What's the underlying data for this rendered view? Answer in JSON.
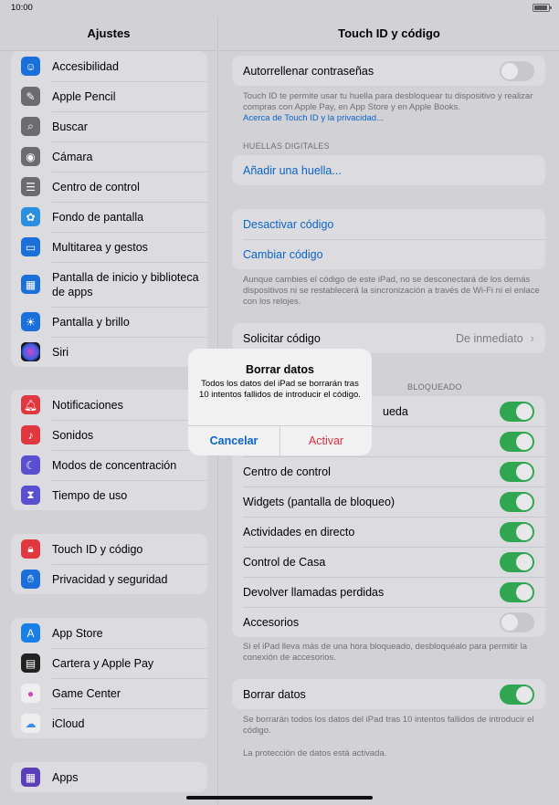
{
  "status_bar": {
    "time": "10:00"
  },
  "sidebar": {
    "title": "Ajustes",
    "groups": [
      [
        {
          "label": "Accesibilidad",
          "icon": "accessibility-icon",
          "color": "#1a6fd8"
        },
        {
          "label": "Apple Pencil",
          "icon": "pencil-icon",
          "color": "#6b6b70"
        },
        {
          "label": "Buscar",
          "icon": "search-icon",
          "color": "#6b6b70"
        },
        {
          "label": "Cámara",
          "icon": "camera-icon",
          "color": "#6b6b70"
        },
        {
          "label": "Centro de control",
          "icon": "control-center-icon",
          "color": "#6b6b70"
        },
        {
          "label": "Fondo de pantalla",
          "icon": "wallpaper-icon",
          "color": "#2b8fe0"
        },
        {
          "label": "Multitarea y gestos",
          "icon": "multitasking-icon",
          "color": "#1a6fd8"
        },
        {
          "label": "Pantalla de inicio y biblioteca de apps",
          "icon": "home-screen-icon",
          "color": "#1a6fd8"
        },
        {
          "label": "Pantalla y brillo",
          "icon": "brightness-icon",
          "color": "#1a6fd8"
        },
        {
          "label": "Siri",
          "icon": "siri-icon",
          "color": "#222"
        }
      ],
      [
        {
          "label": "Notificaciones",
          "icon": "notifications-icon",
          "color": "#e0383e"
        },
        {
          "label": "Sonidos",
          "icon": "sounds-icon",
          "color": "#e0383e"
        },
        {
          "label": "Modos de concentración",
          "icon": "focus-icon",
          "color": "#5a4fcf"
        },
        {
          "label": "Tiempo de uso",
          "icon": "screen-time-icon",
          "color": "#5a4fcf"
        }
      ],
      [
        {
          "label": "Touch ID y código",
          "icon": "lock-icon",
          "color": "#e0383e"
        },
        {
          "label": "Privacidad y seguridad",
          "icon": "hand-icon",
          "color": "#1a6fd8"
        }
      ],
      [
        {
          "label": "App Store",
          "icon": "app-store-icon",
          "color": "#1a7ee8"
        },
        {
          "label": "Cartera y Apple Pay",
          "icon": "wallet-icon",
          "color": "#222"
        },
        {
          "label": "Game Center",
          "icon": "game-center-icon",
          "color": "#eeeeee"
        },
        {
          "label": "iCloud",
          "icon": "icloud-icon",
          "color": "#eeeeee"
        }
      ],
      [
        {
          "label": "Apps",
          "icon": "apps-icon",
          "color": "#5a3fb8"
        }
      ]
    ]
  },
  "detail": {
    "title": "Touch ID y código",
    "autofill": "Autorrellenar contraseñas",
    "touchid_note": "Touch ID te permite usar tu huella para desbloquear tu dispositivo y realizar compras con Apple Pay, en App Store y en Apple Books.",
    "touchid_link": "Acerca de Touch ID y la privacidad...",
    "fingerprints_header": "HUELLAS DIGITALES",
    "add_fingerprint": "Añadir una huella...",
    "disable_code": "Desactivar código",
    "change_code": "Cambiar código",
    "code_note": "Aunque cambies el código de este iPad, no se desconectará de los demás dispositivos ni se restablecerá la sincronización a través de Wi-Fi ni el enlace con los relojes.",
    "require_code": "Solicitar código",
    "require_code_value": "De inmediato",
    "locked_header": "BLOQUEADO",
    "locked_rows": [
      {
        "label": "ueda",
        "on": true
      },
      {
        "label": "",
        "on": true
      },
      {
        "label": "Centro de control",
        "on": true
      },
      {
        "label": "Widgets (pantalla de bloqueo)",
        "on": true
      },
      {
        "label": "Actividades en directo",
        "on": true
      },
      {
        "label": "Control de Casa",
        "on": true
      },
      {
        "label": "Devolver llamadas perdidas",
        "on": true
      },
      {
        "label": "Accesorios",
        "on": false
      }
    ],
    "locked_note": "Si el iPad lleva más de una hora bloqueado, desbloquéalo para permitir la conexión de accesorios.",
    "erase_data": "Borrar datos",
    "erase_note": "Se borrarán todos los datos del iPad tras 10 intentos fallidos de introducir el código.",
    "protection_note": "La protección de datos está activada."
  },
  "alert": {
    "title": "Borrar datos",
    "message": "Todos los datos del iPad se borrarán tras 10 intentos fallidos de introducir el código.",
    "cancel": "Cancelar",
    "activate": "Activar"
  }
}
